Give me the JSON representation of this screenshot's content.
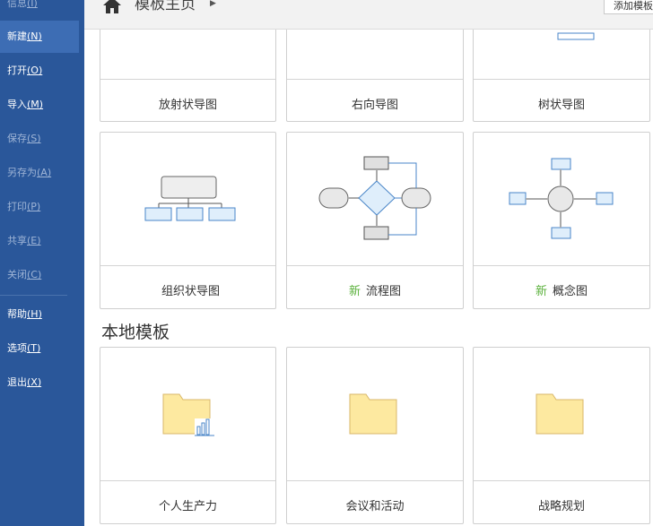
{
  "sidebar": {
    "items": [
      {
        "label": "信息",
        "key": "(I)",
        "state": "disabled"
      },
      {
        "label": "新建",
        "key": "(N)",
        "state": "active"
      },
      {
        "label": "打开",
        "key": "(O)",
        "state": "normal"
      },
      {
        "label": "导入",
        "key": "(M)",
        "state": "normal"
      },
      {
        "label": "保存",
        "key": "(S)",
        "state": "disabled"
      },
      {
        "label": "另存为",
        "key": "(A)",
        "state": "disabled"
      },
      {
        "label": "打印",
        "key": "(P)",
        "state": "disabled"
      },
      {
        "label": "共享",
        "key": "(E)",
        "state": "disabled"
      },
      {
        "label": "关闭",
        "key": "(C)",
        "state": "disabled"
      },
      {
        "label": "帮助",
        "key": "(H)",
        "state": "normal"
      },
      {
        "label": "选项",
        "key": "(T)",
        "state": "normal"
      },
      {
        "label": "退出",
        "key": "(X)",
        "state": "normal"
      }
    ]
  },
  "header": {
    "title": "模板主页",
    "add_button": "添加模板"
  },
  "templates": {
    "row1": [
      {
        "label": "放射状导图"
      },
      {
        "label": "右向导图"
      },
      {
        "label": "树状导图"
      }
    ],
    "row2": [
      {
        "label": "组织状导图",
        "badge": ""
      },
      {
        "label": "流程图",
        "badge": "新"
      },
      {
        "label": "概念图",
        "badge": "新"
      }
    ]
  },
  "local_section": {
    "title": "本地模板",
    "items": [
      {
        "label": "个人生产力"
      },
      {
        "label": "会议和活动"
      },
      {
        "label": "战略规划"
      }
    ]
  },
  "colors": {
    "sidebar_bg": "#2a579a",
    "active_item": "#3d6db4",
    "new_badge": "#5bb13c",
    "folder_fill": "#fde9a0"
  }
}
